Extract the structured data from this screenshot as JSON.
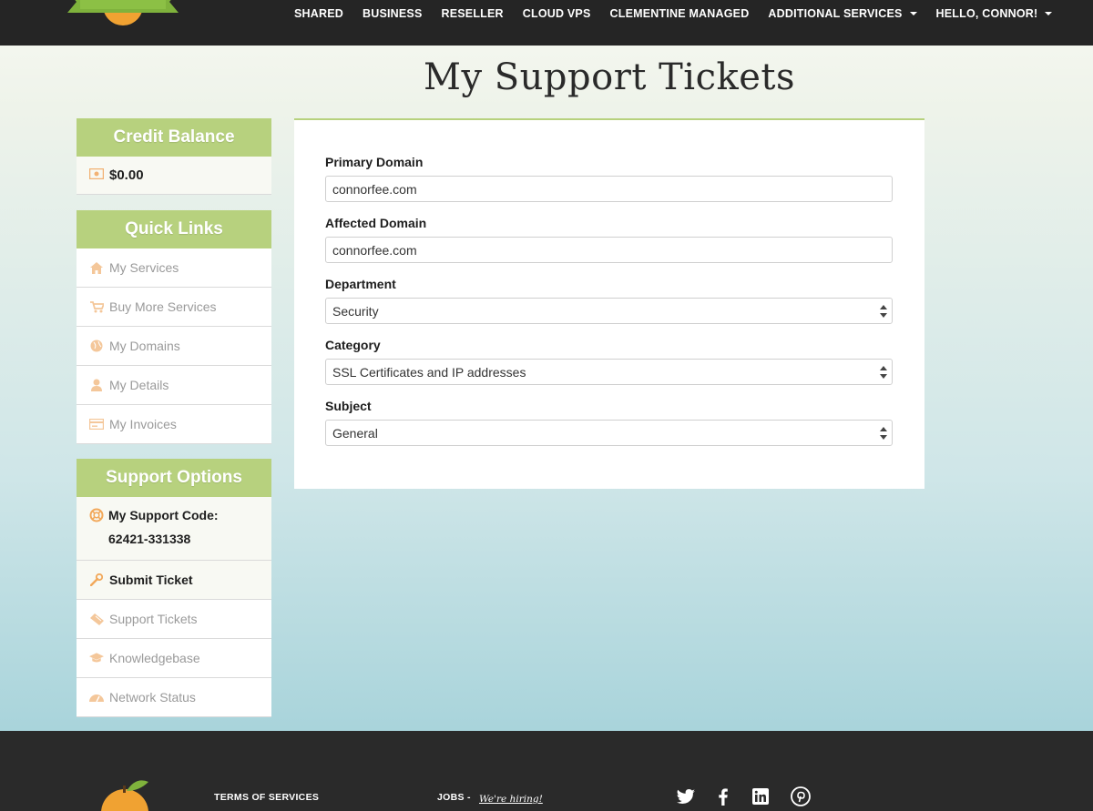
{
  "nav": {
    "items": [
      "SHARED",
      "BUSINESS",
      "RESELLER",
      "CLOUD VPS",
      "CLEMENTINE MANAGED"
    ],
    "additional": "ADDITIONAL SERVICES",
    "user": "HELLO, CONNOR!"
  },
  "page": {
    "title": "My Support Tickets"
  },
  "credit": {
    "heading": "Credit Balance",
    "amount": "$0.00"
  },
  "quick_links": {
    "heading": "Quick Links",
    "items": [
      "My Services",
      "Buy More Services",
      "My Domains",
      "My Details",
      "My Invoices"
    ]
  },
  "support": {
    "heading": "Support Options",
    "code_label": "My Support Code:",
    "code_value": "62421-331338",
    "items": [
      "Submit Ticket",
      "Support Tickets",
      "Knowledgebase",
      "Network Status"
    ]
  },
  "form": {
    "primary_domain_label": "Primary Domain",
    "primary_domain_value": "connorfee.com",
    "affected_domain_label": "Affected Domain",
    "affected_domain_value": "connorfee.com",
    "department_label": "Department",
    "department_value": "Security",
    "category_label": "Category",
    "category_value": "SSL Certificates and IP addresses",
    "subject_label": "Subject",
    "subject_value": "General"
  },
  "footer": {
    "terms": "TERMS OF SERVICES",
    "jobs": "JOBS -",
    "hiring": "We're hiring!"
  },
  "colors": {
    "accent": "#b7d17e",
    "dark": "#252525",
    "icon": "#f2b274"
  }
}
